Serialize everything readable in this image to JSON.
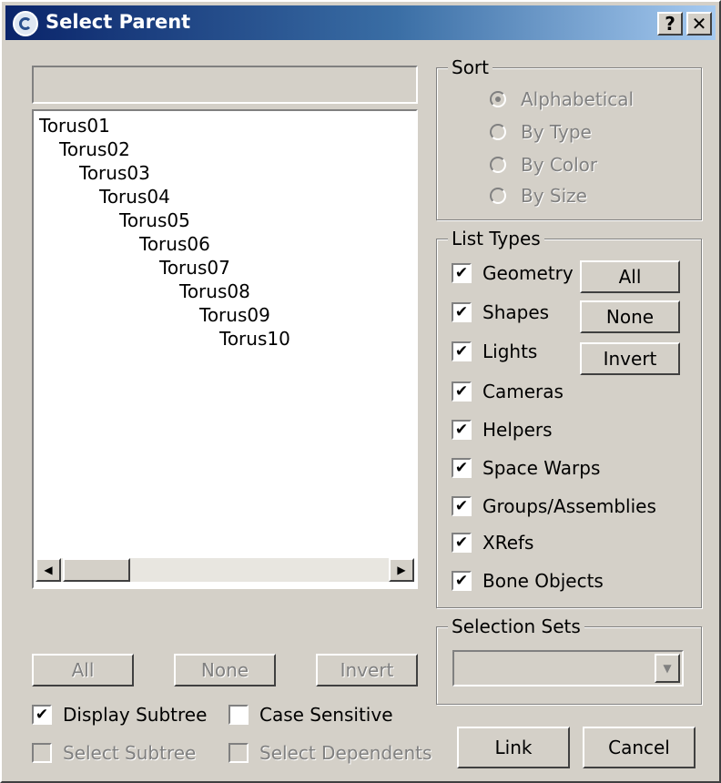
{
  "window": {
    "title": "Select Parent",
    "help_label": "?",
    "close_label": "✕"
  },
  "filter": {
    "value": ""
  },
  "tree": {
    "items": [
      "Torus01",
      "Torus02",
      "Torus03",
      "Torus04",
      "Torus05",
      "Torus06",
      "Torus07",
      "Torus08",
      "Torus09",
      "Torus10"
    ]
  },
  "list_buttons": {
    "all": "All",
    "none": "None",
    "invert": "Invert"
  },
  "options": {
    "display_subtree": {
      "label": "Display Subtree",
      "checked": true
    },
    "case_sensitive": {
      "label": "Case Sensitive",
      "checked": false
    },
    "select_subtree": {
      "label": "Select Subtree",
      "checked": false
    },
    "select_dependents": {
      "label": "Select Dependents",
      "checked": false
    }
  },
  "sort": {
    "title": "Sort",
    "options": [
      "Alphabetical",
      "By Type",
      "By Color",
      "By Size"
    ],
    "selected": "Alphabetical"
  },
  "list_types": {
    "title": "List Types",
    "items": [
      {
        "label": "Geometry",
        "checked": true
      },
      {
        "label": "Shapes",
        "checked": true
      },
      {
        "label": "Lights",
        "checked": true
      },
      {
        "label": "Cameras",
        "checked": true
      },
      {
        "label": "Helpers",
        "checked": true
      },
      {
        "label": "Space Warps",
        "checked": true
      },
      {
        "label": "Groups/Assemblies",
        "checked": true
      },
      {
        "label": "XRefs",
        "checked": true
      },
      {
        "label": "Bone Objects",
        "checked": true
      }
    ],
    "all_label": "All",
    "none_label": "None",
    "invert_label": "Invert"
  },
  "selection_sets": {
    "title": "Selection Sets",
    "value": ""
  },
  "actions": {
    "link": "Link",
    "cancel": "Cancel"
  }
}
